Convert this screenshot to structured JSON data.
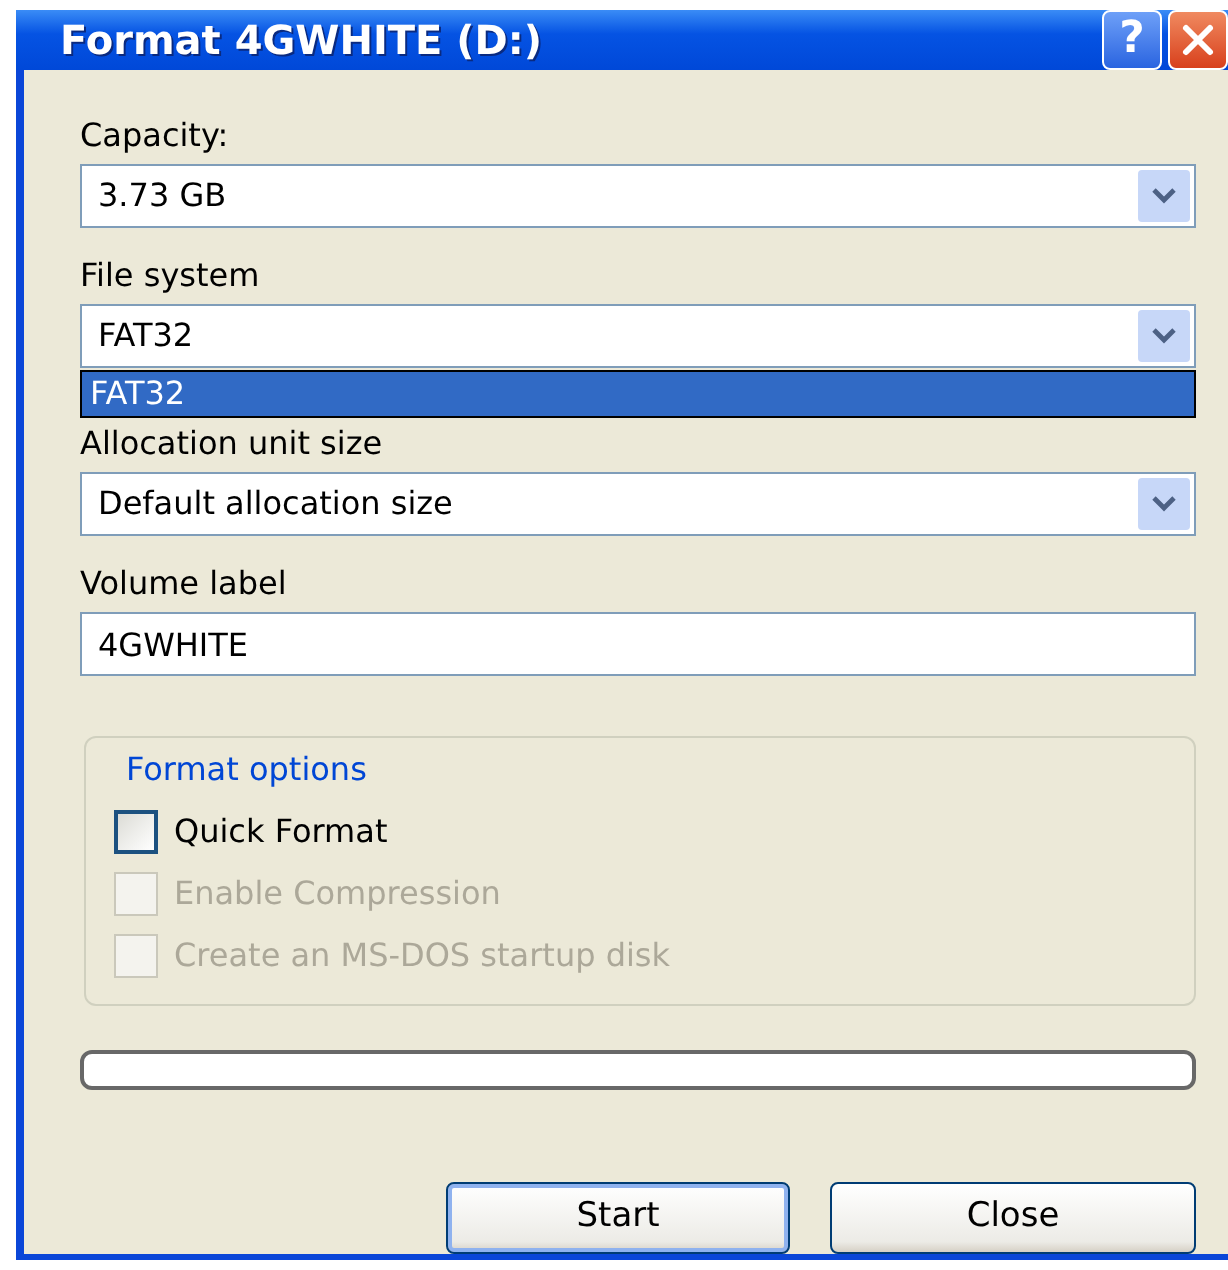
{
  "window": {
    "title": "Format 4GWHITE (D:)"
  },
  "title_buttons": [
    {
      "kind": "help",
      "label": "?"
    },
    {
      "kind": "close"
    }
  ],
  "fields": [
    {
      "kind": "combo",
      "label": "Capacity:",
      "value": "3.73 GB"
    },
    {
      "kind": "combo",
      "label": "File system",
      "value": "FAT32",
      "options": [
        {
          "label": "FAT32",
          "selected": true
        }
      ]
    },
    {
      "kind": "combo",
      "label": "Allocation unit size",
      "value": "Default allocation size"
    },
    {
      "kind": "text",
      "label": "Volume label",
      "value": "4GWHITE"
    }
  ],
  "format_options": {
    "title": "Format options",
    "options": [
      {
        "label": "Quick Format",
        "checked": false,
        "disabled": false
      },
      {
        "label": "Enable Compression",
        "checked": false,
        "disabled": true
      },
      {
        "label": "Create an MS-DOS startup disk",
        "checked": false,
        "disabled": true
      }
    ]
  },
  "progress": {
    "level": 0
  },
  "buttons": [
    {
      "label": "Start",
      "default": true
    },
    {
      "label": "Close",
      "default": false
    }
  ]
}
